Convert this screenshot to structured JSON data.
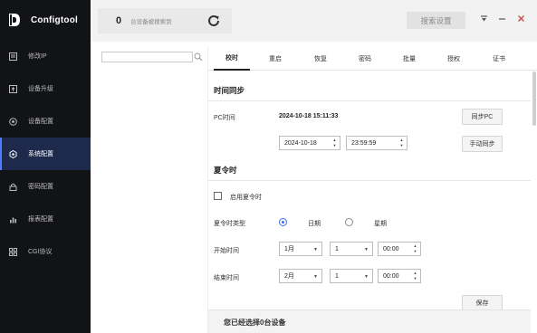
{
  "app": {
    "name": "Configtool"
  },
  "sidebar": {
    "items": [
      {
        "label": "修改IP",
        "icon": "edit-ip-icon",
        "active": false
      },
      {
        "label": "设备升级",
        "icon": "upgrade-icon",
        "active": false
      },
      {
        "label": "设备配置",
        "icon": "device-config-icon",
        "active": false
      },
      {
        "label": "系统配置",
        "icon": "system-config-icon",
        "active": true
      },
      {
        "label": "密码配置",
        "icon": "lock-icon",
        "active": false
      },
      {
        "label": "报表配置",
        "icon": "chart-icon",
        "active": false
      },
      {
        "label": "CGI协议",
        "icon": "protocol-icon",
        "active": false
      }
    ]
  },
  "topbar": {
    "device_count": "0",
    "device_count_text": "台设备被搜索到",
    "search_button": "搜索设置",
    "window_controls": [
      "filter-icon",
      "minimize-icon",
      "close-icon"
    ]
  },
  "tabs": [
    "校时",
    "重启",
    "恢复",
    "密码",
    "批量",
    "授权",
    "证书"
  ],
  "time_sync": {
    "title": "时间同步",
    "pc_time_label": "PC时间",
    "pc_time_value": "2024-10-18 15:11:33",
    "sync_pc_button": "同步PC",
    "date_value": "2024-10-18",
    "time_value": "23:59:59",
    "manual_sync_button": "手动同步"
  },
  "dst": {
    "title": "夏令时",
    "enable_label": "启用夏令时",
    "enabled": false,
    "type_label": "夏令时类型",
    "type_options": [
      "日期",
      "星期"
    ],
    "type_selected": "日期",
    "start_label": "开始时间",
    "start_month": "1月",
    "start_day": "1",
    "start_time": "00:00",
    "end_label": "结束时间",
    "end_month": "2月",
    "end_day": "1",
    "end_time": "00:00",
    "save_button": "保存"
  },
  "footer": {
    "text": "您已经选择0台设备"
  },
  "colors": {
    "sidebar_bg": "#121316",
    "active_item_bg": "#1e2a4b",
    "accent": "#3c6cf0"
  }
}
